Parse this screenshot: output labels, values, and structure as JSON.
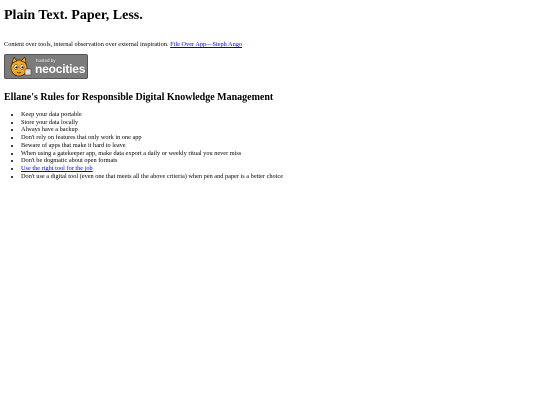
{
  "page": {
    "title": "Plain Text. Paper, Less.",
    "tagline": "Content over tools, internal observation over external inspiration.",
    "tagline_link": "File Over App—Steph Ango"
  },
  "badge": {
    "hosted_by": "hosted by",
    "brand": "neocities",
    "icon": "neocities-cat-icon"
  },
  "rules": {
    "heading": "Ellane's Rules for Responsible Digital Knowledge Management",
    "items": [
      "Keep your data portable",
      "Store your data locally",
      "Always have a backup",
      "Don't rely on features that only work in one app",
      "Beware of apps that make it hard to leave",
      "When using a gatekeeper app, make data export a daily or weekly ritual you never miss",
      "Don't be dogmatic about open formats",
      "Use the right tool for the job",
      "Don't use a digital tool (even one that meets all the above criteria) when pen and paper is a better choice"
    ]
  },
  "colors": {
    "link": "#0000ee",
    "badge_bg": "#7b7b7b"
  }
}
